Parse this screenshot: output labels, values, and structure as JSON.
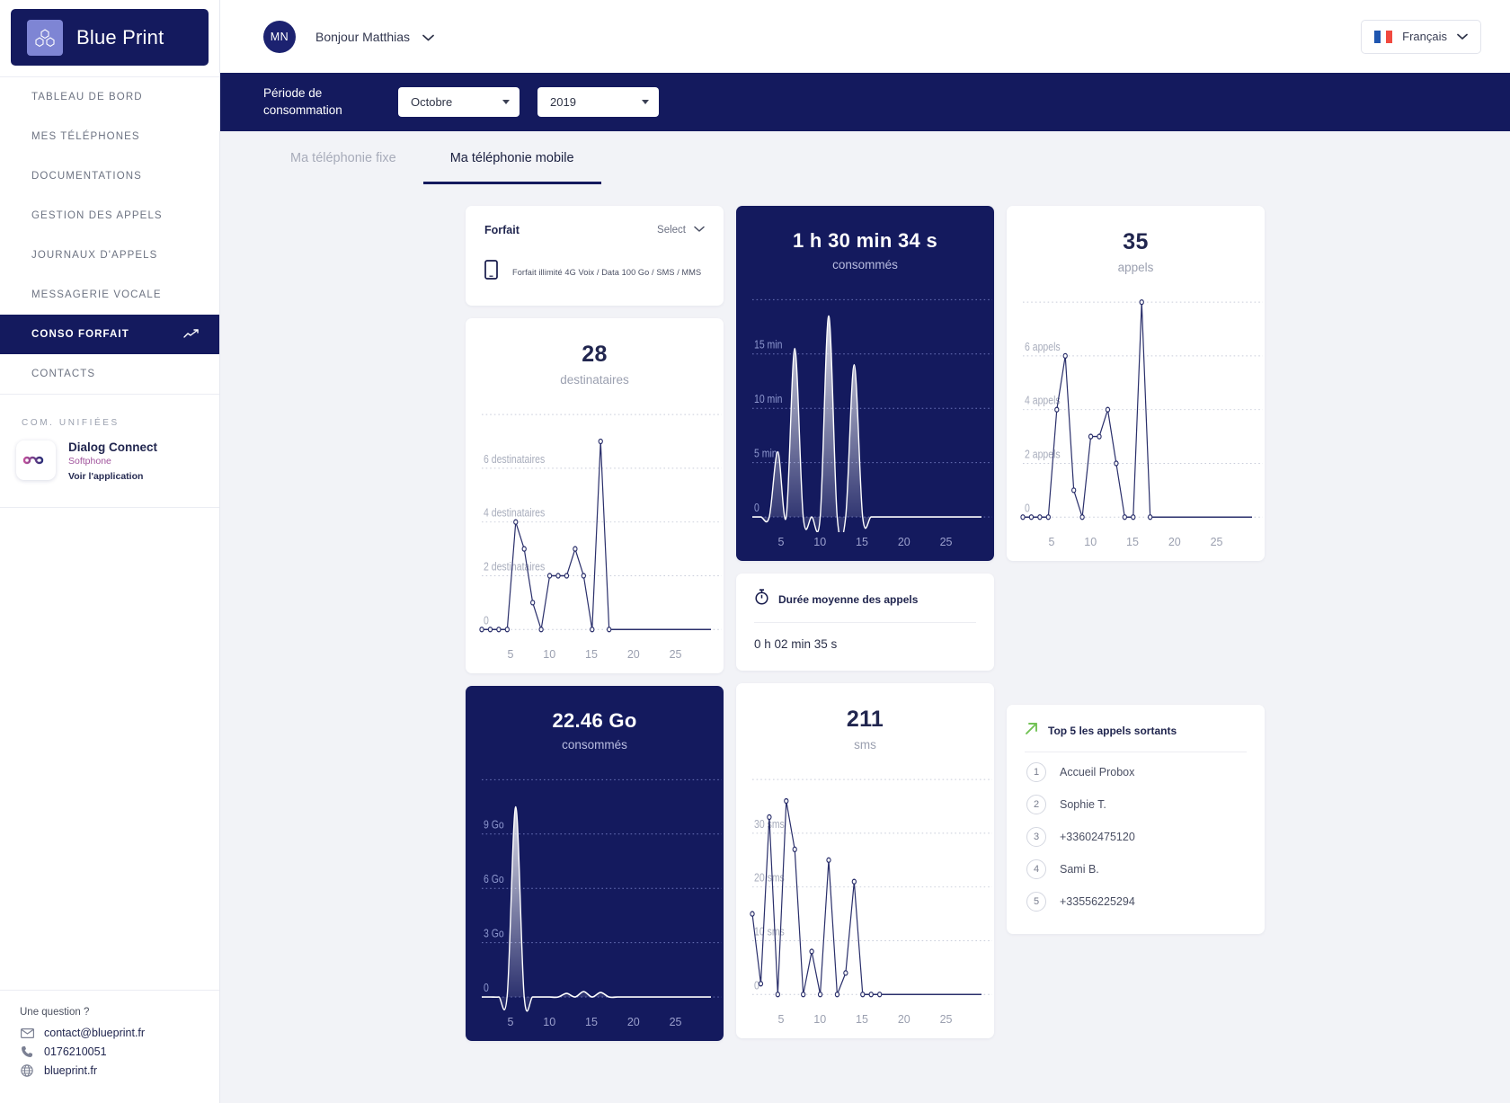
{
  "sidebar": {
    "brand": "Blue Print",
    "nav": [
      {
        "label": "TABLEAU DE BORD",
        "active": false
      },
      {
        "label": "MES TÉLÉPHONES",
        "active": false
      },
      {
        "label": "DOCUMENTATIONS",
        "active": false
      },
      {
        "label": "GESTION DES APPELS",
        "active": false
      },
      {
        "label": "JOURNAUX D'APPELS",
        "active": false
      },
      {
        "label": "MESSAGERIE VOCALE",
        "active": false
      },
      {
        "label": "CONSO FORFAIT",
        "active": true
      },
      {
        "label": "CONTACTS",
        "active": false
      }
    ],
    "section_title": "COM. UNIFIÉES",
    "app": {
      "name": "Dialog Connect",
      "type": "Softphone",
      "link": "Voir l'application"
    },
    "footer": {
      "question": "Une question ?",
      "email": "contact@blueprint.fr",
      "phone": "0176210051",
      "website": "blueprint.fr"
    }
  },
  "topbar": {
    "avatar_initials": "MN",
    "greeting": "Bonjour Matthias",
    "language": "Français"
  },
  "period": {
    "label": "Période de consommation",
    "month": "Octobre",
    "year": "2019"
  },
  "tabs": [
    {
      "label": "Ma téléphonie fixe",
      "active": false
    },
    {
      "label": "Ma téléphonie mobile",
      "active": true
    }
  ],
  "forfait": {
    "title": "Forfait",
    "select_label": "Select",
    "description": "Forfait illimité 4G Voix / Data 100 Go / SMS / MMS"
  },
  "duree_moyenne": {
    "title": "Durée moyenne des appels",
    "value": "0 h 02 min 35 s"
  },
  "top5": {
    "title": "Top 5 les appels sortants",
    "items": [
      {
        "rank": "1",
        "name": "Accueil Probox"
      },
      {
        "rank": "2",
        "name": "Sophie T."
      },
      {
        "rank": "3",
        "name": "+33602475120"
      },
      {
        "rank": "4",
        "name": "Sami B."
      },
      {
        "rank": "5",
        "name": "+33556225294"
      }
    ]
  },
  "colors": {
    "brand_dark": "#141a5e",
    "accent_purple": "#7e85d4",
    "line_navy": "#2a2f6b",
    "green": "#72c255",
    "muted": "#9ba0b0"
  },
  "chart_data": [
    {
      "id": "destinataires",
      "type": "line",
      "title": "28",
      "subtitle": "destinataires",
      "theme": "light",
      "ylabels": [
        "0",
        "2 destinataires",
        "4 destinataires",
        "6 destinataires"
      ],
      "yticks": [
        0,
        2,
        4,
        6
      ],
      "ylim": [
        0,
        8
      ],
      "xticks": [
        5,
        10,
        15,
        20,
        25
      ],
      "xlim": [
        1,
        28
      ],
      "x": [
        1,
        2,
        3,
        4,
        5,
        6,
        7,
        8,
        9,
        10,
        11,
        12,
        13,
        14,
        15,
        16,
        17,
        18,
        19,
        20,
        21,
        22,
        23,
        24,
        25,
        26,
        27,
        28
      ],
      "values": [
        0,
        0,
        0,
        0,
        4,
        3,
        1,
        0,
        2,
        2,
        2,
        3,
        2,
        0,
        7,
        0,
        0,
        0,
        0,
        0,
        0,
        0,
        0,
        0,
        0,
        0,
        0,
        0
      ],
      "markers": true
    },
    {
      "id": "duree",
      "type": "area",
      "title": "1 h 30 min 34 s",
      "subtitle": "consommés",
      "theme": "dark",
      "ylabels": [
        "0",
        "5 min",
        "10 min",
        "15 min"
      ],
      "yticks": [
        0,
        5,
        10,
        15
      ],
      "ylim": [
        0,
        20
      ],
      "xticks": [
        5,
        10,
        15,
        20,
        25
      ],
      "xlim": [
        1,
        28
      ],
      "x": [
        1,
        2,
        3,
        4,
        5,
        6,
        7,
        8,
        9,
        10,
        11,
        12,
        13,
        14,
        15,
        16,
        17,
        18,
        19,
        20,
        21,
        22,
        23,
        24,
        25,
        26,
        27,
        28
      ],
      "values": [
        0,
        0,
        0,
        6,
        0,
        15.5,
        0,
        0,
        0,
        18.5,
        0,
        0,
        14,
        0,
        0,
        0,
        0,
        0,
        0,
        0,
        0,
        0,
        0,
        0,
        0,
        0,
        0,
        0
      ],
      "smooth": true
    },
    {
      "id": "appels",
      "type": "line",
      "title": "35",
      "subtitle": "appels",
      "theme": "light",
      "ylabels": [
        "0",
        "2 appels",
        "4 appels",
        "6 appels"
      ],
      "yticks": [
        0,
        2,
        4,
        6
      ],
      "ylim": [
        0,
        8
      ],
      "xticks": [
        5,
        10,
        15,
        20,
        25
      ],
      "xlim": [
        1,
        28
      ],
      "x": [
        1,
        2,
        3,
        4,
        5,
        6,
        7,
        8,
        9,
        10,
        11,
        12,
        13,
        14,
        15,
        16,
        17,
        18,
        19,
        20,
        21,
        22,
        23,
        24,
        25,
        26,
        27,
        28
      ],
      "values": [
        0,
        0,
        0,
        0,
        4,
        6,
        1,
        0,
        3,
        3,
        4,
        2,
        0,
        0,
        8,
        0,
        0,
        0,
        0,
        0,
        0,
        0,
        0,
        0,
        0,
        0,
        0,
        0
      ],
      "markers": true
    },
    {
      "id": "data",
      "type": "area",
      "title": "22.46 Go",
      "subtitle": "consommés",
      "theme": "dark",
      "ylabels": [
        "0",
        "3 Go",
        "6 Go",
        "9 Go"
      ],
      "yticks": [
        0,
        3,
        6,
        9
      ],
      "ylim": [
        0,
        12
      ],
      "xticks": [
        5,
        10,
        15,
        20,
        25
      ],
      "xlim": [
        1,
        28
      ],
      "x": [
        1,
        2,
        3,
        4,
        5,
        6,
        7,
        8,
        9,
        10,
        11,
        12,
        13,
        14,
        15,
        16,
        17,
        18,
        19,
        20,
        21,
        22,
        23,
        24,
        25,
        26,
        27,
        28
      ],
      "values": [
        0,
        0,
        0,
        0.1,
        10.5,
        0,
        0,
        0,
        0,
        0,
        0.2,
        0,
        0.3,
        0,
        0.25,
        0,
        0,
        0,
        0,
        0,
        0,
        0,
        0,
        0,
        0,
        0,
        0,
        0
      ],
      "smooth": true
    },
    {
      "id": "sms",
      "type": "line",
      "title": "211",
      "subtitle": "sms",
      "theme": "light",
      "ylabels": [
        "0",
        "10 sms",
        "20 sms",
        "30 sms"
      ],
      "yticks": [
        0,
        10,
        20,
        30
      ],
      "ylim": [
        0,
        40
      ],
      "xticks": [
        5,
        10,
        15,
        20,
        25
      ],
      "xlim": [
        1,
        28
      ],
      "x": [
        1,
        2,
        3,
        4,
        5,
        6,
        7,
        8,
        9,
        10,
        11,
        12,
        13,
        14,
        15,
        16,
        17,
        18,
        19,
        20,
        21,
        22,
        23,
        24,
        25,
        26,
        27,
        28
      ],
      "values": [
        15,
        2,
        33,
        0,
        36,
        27,
        0,
        8,
        0,
        25,
        0,
        4,
        21,
        0,
        0,
        0,
        0,
        0,
        0,
        0,
        0,
        0,
        0,
        0,
        0,
        0,
        0,
        0
      ],
      "markers": true
    }
  ]
}
